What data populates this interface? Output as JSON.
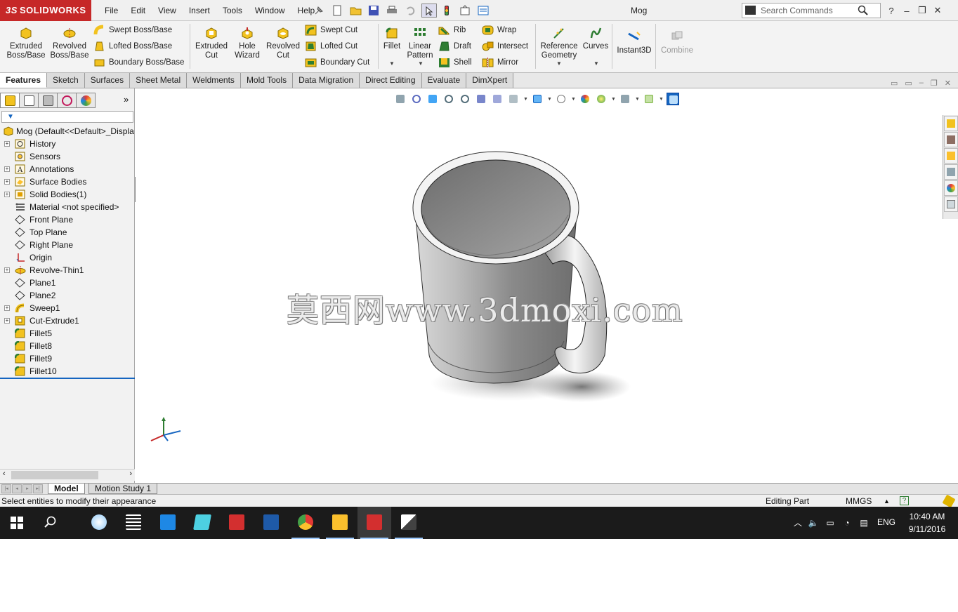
{
  "app": {
    "brand": "SOLIDWORKS",
    "brand_prefix": "3S",
    "document_title": "Mog"
  },
  "menu": [
    "File",
    "Edit",
    "View",
    "Insert",
    "Tools",
    "Window",
    "Help"
  ],
  "search": {
    "placeholder": "Search Commands"
  },
  "window_controls": [
    "?",
    "–",
    "❐",
    "✕"
  ],
  "command_manager": {
    "extruded_boss": "Extruded\nBoss/Base",
    "revolved_boss": "Revolved\nBoss/Base",
    "swept_boss": "Swept Boss/Base",
    "lofted_boss": "Lofted Boss/Base",
    "boundary_boss": "Boundary Boss/Base",
    "extruded_cut": "Extruded\nCut",
    "hole_wizard": "Hole\nWizard",
    "revolved_cut": "Revolved\nCut",
    "swept_cut": "Swept Cut",
    "lofted_cut": "Lofted Cut",
    "boundary_cut": "Boundary Cut",
    "fillet": "Fillet",
    "linear_pattern": "Linear\nPattern",
    "rib": "Rib",
    "draft": "Draft",
    "shell": "Shell",
    "wrap": "Wrap",
    "intersect": "Intersect",
    "mirror": "Mirror",
    "reference_geometry": "Reference\nGeometry",
    "curves": "Curves",
    "instant3d": "Instant3D",
    "combine": "Combine"
  },
  "tabs": [
    "Features",
    "Sketch",
    "Surfaces",
    "Sheet Metal",
    "Weldments",
    "Mold Tools",
    "Data Migration",
    "Direct Editing",
    "Evaluate",
    "DimXpert"
  ],
  "active_tab": "Features",
  "feature_tree": {
    "root": "Mog  (Default<<Default>_Displa",
    "items": [
      {
        "label": "History",
        "icon": "history-icon",
        "expand": true
      },
      {
        "label": "Sensors",
        "icon": "sensor-icon",
        "expand": false
      },
      {
        "label": "Annotations",
        "icon": "annotation-icon",
        "expand": true
      },
      {
        "label": "Surface Bodies",
        "icon": "surface-bodies-icon",
        "expand": true
      },
      {
        "label": "Solid Bodies(1)",
        "icon": "solid-bodies-icon",
        "expand": true
      },
      {
        "label": "Material <not specified>",
        "icon": "material-icon",
        "expand": false
      },
      {
        "label": "Front Plane",
        "icon": "plane-icon",
        "expand": false
      },
      {
        "label": "Top Plane",
        "icon": "plane-icon",
        "expand": false
      },
      {
        "label": "Right Plane",
        "icon": "plane-icon",
        "expand": false
      },
      {
        "label": "Origin",
        "icon": "origin-icon",
        "expand": false
      },
      {
        "label": "Revolve-Thin1",
        "icon": "revolve-icon",
        "expand": true
      },
      {
        "label": "Plane1",
        "icon": "plane-icon",
        "expand": false
      },
      {
        "label": "Plane2",
        "icon": "plane-icon",
        "expand": false
      },
      {
        "label": "Sweep1",
        "icon": "sweep-icon",
        "expand": true
      },
      {
        "label": "Cut-Extrude1",
        "icon": "cut-extrude-icon",
        "expand": true
      },
      {
        "label": "Fillet5",
        "icon": "fillet-icon",
        "expand": false
      },
      {
        "label": "Fillet8",
        "icon": "fillet-icon",
        "expand": false
      },
      {
        "label": "Fillet9",
        "icon": "fillet-icon",
        "expand": false
      },
      {
        "label": "Fillet10",
        "icon": "fillet-icon",
        "expand": false
      }
    ]
  },
  "watermark": "莫西网www.3dmoxi.com",
  "bottom_tabs": {
    "model": "Model",
    "motion": "Motion Study 1"
  },
  "status": {
    "message": "Select entities to modify their appearance",
    "mode": "Editing Part",
    "units": "MMGS"
  },
  "taskbar": {
    "language": "ENG",
    "time": "10:40 AM",
    "date": "9/11/2016"
  },
  "colors": {
    "brand_red": "#c62828",
    "feature_tree_accent": "#1565c0",
    "taskbar": "#1b1b1b"
  }
}
